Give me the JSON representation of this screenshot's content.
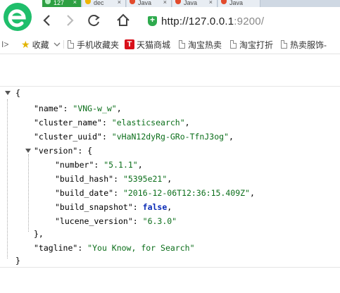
{
  "browser": {
    "tabs": [
      {
        "label": "127",
        "icon": "green-tab-icon",
        "active": true
      },
      {
        "label": "dec",
        "icon": "yellow-tab-icon",
        "active": false
      },
      {
        "label": "Java",
        "icon": "red-tab-icon",
        "active": false
      },
      {
        "label": "Java",
        "icon": "red-tab-icon",
        "active": false
      },
      {
        "label": "Java",
        "icon": "red-tab-icon",
        "active": false
      }
    ],
    "close_glyph": "×",
    "url": "http://127.0.0.1",
    "url_port": ":9200/",
    "colors": {
      "accent": "#2ea043",
      "logo": "#1fbe6b",
      "tmall": "#d8101a"
    }
  },
  "bookmarks": {
    "collapse_glyph": "I>",
    "items": [
      {
        "label": "收藏",
        "icon": "star-icon",
        "has_dropdown": true
      },
      {
        "label": "手机收藏夹",
        "icon": "page-icon"
      },
      {
        "label": "天猫商城",
        "icon": "tmall-icon",
        "icon_text": "T"
      },
      {
        "label": "淘宝热卖",
        "icon": "page-icon"
      },
      {
        "label": "淘宝打折",
        "icon": "page-icon"
      },
      {
        "label": "热卖服饰-",
        "icon": "page-icon"
      }
    ]
  },
  "json": {
    "open_brace": "{",
    "close_brace": "}",
    "name_key": "\"name\"",
    "name_val": "\"VNG-w_w\"",
    "cluster_name_key": "\"cluster_name\"",
    "cluster_name_val": "\"elasticsearch\"",
    "cluster_uuid_key": "\"cluster_uuid\"",
    "cluster_uuid_val": "\"vHaN12dyRg-GRo-TfnJ3og\"",
    "version_key": "\"version\"",
    "number_key": "\"number\"",
    "number_val": "\"5.1.1\"",
    "build_hash_key": "\"build_hash\"",
    "build_hash_val": "\"5395e21\"",
    "build_date_key": "\"build_date\"",
    "build_date_val": "\"2016-12-06T12:36:15.409Z\"",
    "build_snapshot_key": "\"build_snapshot\"",
    "build_snapshot_val": "false",
    "lucene_version_key": "\"lucene_version\"",
    "lucene_version_val": "\"6.3.0\"",
    "version_close": "},",
    "tagline_key": "\"tagline\"",
    "tagline_val": "\"You Know, for Search\""
  }
}
